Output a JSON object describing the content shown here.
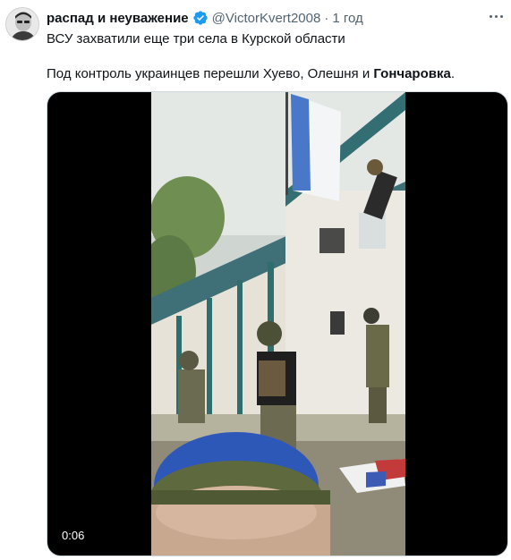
{
  "author": {
    "display_name": "распад и неуважение",
    "handle": "@VictorKvert2008",
    "separator": "·",
    "time": "1 год",
    "verified": true
  },
  "tweet": {
    "line1": "ВСУ захватили еще три села в Курской области",
    "line2_prefix": "Под контроль украинцев перешли Хуево, Олешня и ",
    "line2_bold": "Гончаровка",
    "line2_suffix": "."
  },
  "video": {
    "duration": "0:06"
  },
  "icons": {
    "verified": "verified-badge-icon",
    "more": "more-options-icon"
  },
  "colors": {
    "verified_blue": "#1d9bf0",
    "text_primary": "#0f1419",
    "text_secondary": "#536471"
  }
}
